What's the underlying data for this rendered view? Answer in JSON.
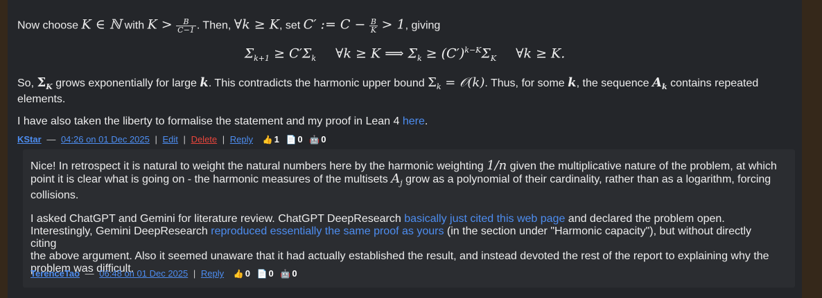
{
  "comment": {
    "p1_pre": "Now choose ",
    "p1_mid1": " with ",
    "p1_mid2": ". Then, ",
    "p1_mid3": ", set ",
    "p1_end": ", giving",
    "m_K_in_N": "K ∈ ℕ",
    "m_K_gt": "K >",
    "frac_num": "B",
    "frac_den": "C−1",
    "m_forall": "∀k ≥ K",
    "m_cprime": "C′ := C −",
    "frac2_num": "B",
    "frac2_den": "K",
    "m_gt1": "> 1",
    "display_left": "Σ",
    "display_sub1": "k+1",
    "display_rel1": " ≥ C′Σ",
    "display_sub2": "k",
    "display_forall1": "∀k ≥ K ⟹ Σ",
    "display_sub3": "k",
    "display_rel2": " ≥ (C′)",
    "display_sup": "k−K",
    "display_sigma": "Σ",
    "display_sub4": "K",
    "display_forall2": "∀k ≥ K.",
    "p2_a": "So, ",
    "p2_sigmaK": "Σ",
    "p2_sigmaK_sub": "K",
    "p2_b": " grows exponentially for large ",
    "p2_k": "k",
    "p2_c": ". This contradicts the harmonic upper bound ",
    "p2_bound": "Σ",
    "p2_bound_sub": "k",
    "p2_bound_rest": " = 𝒪(k)",
    "p2_d": ". Thus, for some ",
    "p2_e": ", the sequence ",
    "p2_A": "A",
    "p2_A_sub": "k",
    "p2_f": " contains repeated",
    "p2_g": "elements.",
    "p3_text": "I have also taken the liberty to formalise the statement and my proof in Lean 4 ",
    "p3_link": "here",
    "p3_end": ".",
    "meta": {
      "user": "KStar",
      "dash": "—",
      "time": "04:26 on 01 Dec 2025",
      "edit": "Edit",
      "delete": "Delete",
      "reply": "Reply",
      "likes": "1",
      "docs": "0",
      "bots": "0"
    }
  },
  "reply": {
    "r1a": "Nice! In retrospect it is natural to weight the natural numbers here by the harmonic weighting ",
    "r1_m": "1/n",
    "r1b": " given the multiplicative nature of the problem, at which",
    "r1c": "point it is clear what is going on - the harmonic measures of the multisets ",
    "r1_A": "A",
    "r1_A_sub": "j",
    "r1d": " grow as a polynomial of their cardinality, rather than as a logarithm, forcing",
    "r1e": "collisions.",
    "r2a": "I asked ChatGPT and Gemini for literature review. ChatGPT DeepResearch ",
    "r2_link1": "basically just cited this web page",
    "r2b": " and declared the problem open.",
    "r2c": "Interestingly, Gemini DeepResearch ",
    "r2_link2": "reproduced essentially the same proof as yours",
    "r2d": " (in the section under \"Harmonic capacity\"), but without directly citing",
    "r2e": "the above argument. Also it seemed unaware that it had actually established the result, and instead devoted the rest of the report to explaining why the",
    "r2f": "problem was difficult.",
    "meta": {
      "user": "TerenceTao",
      "dash": "—",
      "time": "06:48 on 01 Dec 2025",
      "reply": "Reply",
      "likes": "0",
      "docs": "0",
      "bots": "0"
    }
  },
  "icons": {
    "like": "👍",
    "doc": "📄",
    "bot": "🤖"
  },
  "colors": {
    "background_outer": "#35281a",
    "panel": "#24262a",
    "reply_box": "#2b2d31",
    "link": "#4d8df0",
    "delete": "#e8453c",
    "text": "#ececec"
  }
}
